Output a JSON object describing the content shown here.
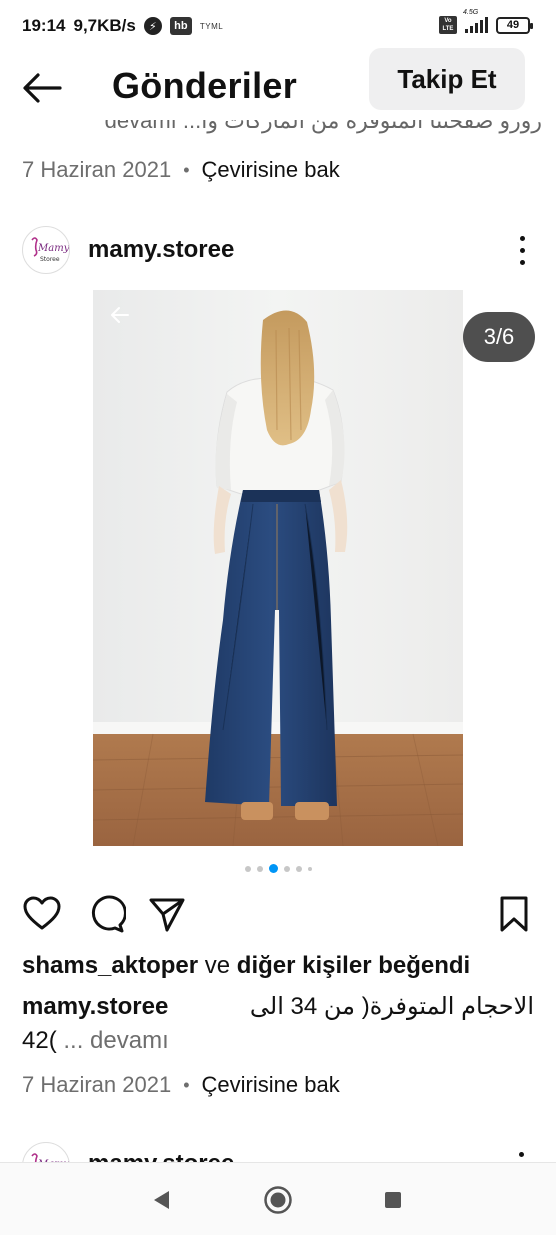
{
  "status_bar": {
    "time": "19:14",
    "speed": "9,7KB/s",
    "app_badge": "hb",
    "carrier_tag": "TYML",
    "volte": "Vo LTE",
    "network": "4.5G",
    "battery": "49"
  },
  "header": {
    "title": "Gönderiler",
    "follow_label": "Takip Et"
  },
  "previous_post": {
    "caption_fragment": "زوزو صفحتنا المتوفرة من الماركات وا... devamı",
    "date": "7 Haziran 2021",
    "separator": "•",
    "translate_label": "Çevirisine bak"
  },
  "post": {
    "username": "mamy.storee",
    "avatar_text": "Mamy",
    "avatar_subtext": "Storee",
    "image_counter": "3/6",
    "carousel": {
      "total": 6,
      "active": 3
    },
    "likes_user": "shams_aktoper",
    "likes_connector": "ve",
    "likes_rest": "diğer kişiler beğendi",
    "caption_user": "mamy.storee",
    "caption_arabic": "الاحجام المتوفرة( من 34 الى",
    "caption_line2": "42(",
    "caption_more": "... devamı",
    "date": "7 Haziran 2021",
    "separator": "•",
    "translate_label": "Çevirisine bak"
  },
  "next_post": {
    "username": "mamy.storee"
  },
  "colors": {
    "accent": "#0095f6",
    "muted_text": "#6e6e6e",
    "follow_bg": "#efeff0",
    "counter_bg": "#333333"
  },
  "icons": {
    "back": "arrow-left-icon",
    "more": "more-vertical-icon",
    "like": "heart-icon",
    "comment": "comment-icon",
    "share": "send-icon",
    "save": "bookmark-icon",
    "nav_back": "triangle-back-icon",
    "nav_home": "circle-home-icon",
    "nav_recent": "square-recent-icon"
  }
}
